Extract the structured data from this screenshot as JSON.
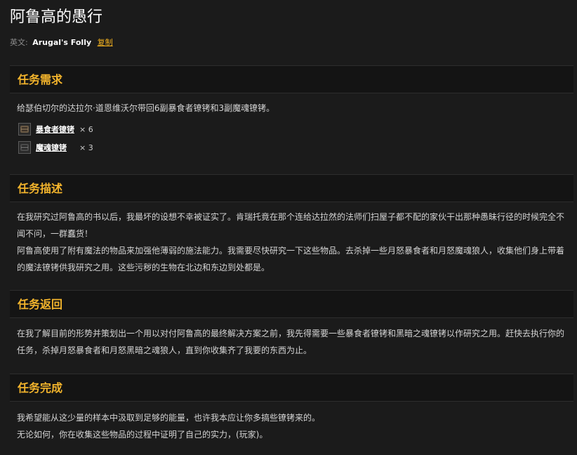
{
  "quest": {
    "title": "阿鲁高的愚行",
    "en_prefix": "英文:",
    "en_name": "Arugal's Folly",
    "copy_label": "复制"
  },
  "requirements": {
    "heading": "任务需求",
    "text": "给瑟伯切尔的达拉尔·道恩维沃尔带回6副暴食者镣铐和3副魔魂镣铐。",
    "items": [
      {
        "name": "暴食者镣铐",
        "qty": "× 6",
        "icon": "shackle-icon"
      },
      {
        "name": "魔魂镣铐",
        "qty": "× 3",
        "icon": "shackle-icon"
      }
    ]
  },
  "description": {
    "heading": "任务描述",
    "paragraph1": "在我研究过阿鲁高的书以后，我最坏的设想不幸被证实了。肯瑞托竟在那个连给达拉然的法师们扫屋子都不配的家伙干出那种愚昧行径的时候完全不闻不问，一群蠢货！",
    "paragraph2": "阿鲁高使用了附有魔法的物品来加强他薄弱的施法能力。我需要尽快研究一下这些物品。去杀掉一些月怒暴食者和月怒魔魂狼人，收集他们身上带着的魔法镣铐供我研究之用。这些污秽的生物在北边和东边到处都是。"
  },
  "return": {
    "heading": "任务返回",
    "text": "在我了解目前的形势并策划出一个用以对付阿鲁高的最终解决方案之前，我先得需要一些暴食者镣铐和黑暗之魂镣铐以作研究之用。赶快去执行你的任务，杀掉月怒暴食者和月怒黑暗之魂狼人，直到你收集齐了我要的东西为止。"
  },
  "completion": {
    "heading": "任务完成",
    "line1": "我希望能从这少量的样本中汲取到足够的能量，也许我本应让你多搞些镣铐来的。",
    "line2": "无论如何，你在收集这些物品的过程中证明了自己的实力，(玩家)。"
  },
  "colors": {
    "background": "#1b1b1b",
    "header_background": "#141414",
    "accent": "#f3b42c",
    "link": "#f1b01f"
  }
}
